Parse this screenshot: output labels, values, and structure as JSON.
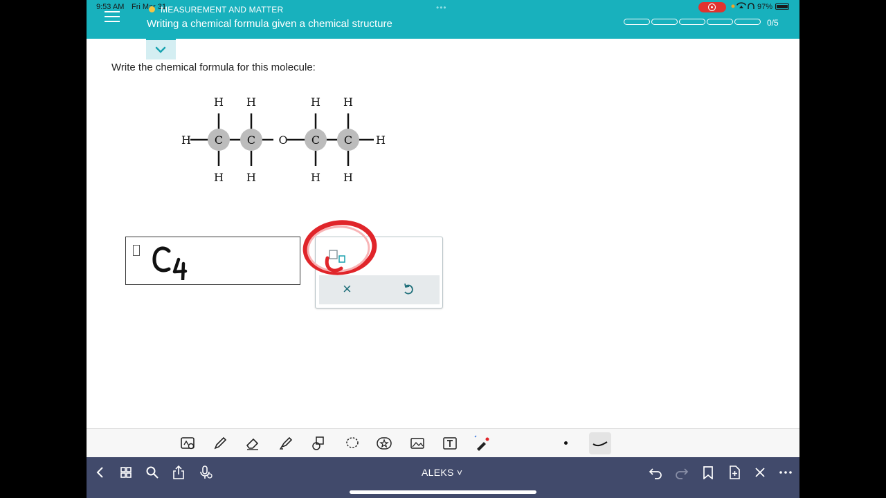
{
  "status_bar": {
    "time": "9:53 AM",
    "date": "Fri Mar 31",
    "battery": "97%"
  },
  "header": {
    "category": "MEASUREMENT AND MATTER",
    "title": "Writing a chemical formula given a chemical structure",
    "progress_segments": 5,
    "progress_filled": 0,
    "progress_label": "0/5"
  },
  "question": {
    "prompt": "Write the chemical formula for this molecule:"
  },
  "molecule": {
    "atoms": [
      "H",
      "C",
      "C",
      "O",
      "C",
      "C",
      "H"
    ],
    "top_h": [
      "H",
      "H",
      "H",
      "H"
    ],
    "bottom_h": [
      "H",
      "H",
      "H",
      "H"
    ]
  },
  "answer": {
    "handwritten_entry": "C4"
  },
  "palette": {
    "subscript_tool": "subscript-icon",
    "clear_icon": "×",
    "undo_icon": "undo-icon"
  },
  "bottom_bar": {
    "app_title": "ALEKS ˅"
  },
  "colors": {
    "header": "#18b1bd",
    "bottom_bar": "#414a6b",
    "atom_fill": "#bcbcbc",
    "annotation_red": "#e0252a"
  }
}
